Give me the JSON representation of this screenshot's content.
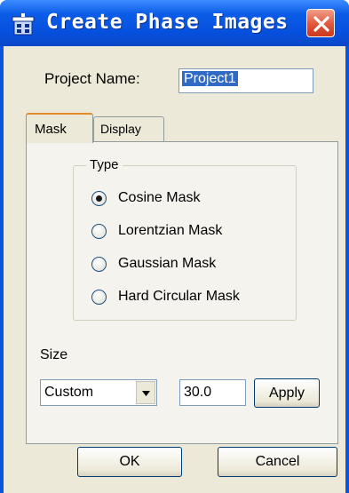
{
  "window": {
    "title": "Create Phase Images",
    "app_icon": "phase-images-app-icon",
    "close_icon": "close-icon"
  },
  "project": {
    "label": "Project Name:",
    "value": "Project1"
  },
  "tabs": [
    {
      "label": "Mask",
      "selected": true
    },
    {
      "label": "Display",
      "selected": false
    }
  ],
  "mask": {
    "type_group_label": "Type",
    "options": [
      {
        "label": "Cosine Mask",
        "checked": true
      },
      {
        "label": "Lorentzian Mask",
        "checked": false
      },
      {
        "label": "Gaussian Mask",
        "checked": false
      },
      {
        "label": "Hard Circular Mask",
        "checked": false
      }
    ],
    "size_label": "Size",
    "size_mode": "Custom",
    "size_value": "30.0",
    "apply_label": "Apply"
  },
  "buttons": {
    "ok": "OK",
    "cancel": "Cancel"
  },
  "colors": {
    "titlebar": "#0a55e0",
    "dialog_bg": "#ece9d8",
    "selection": "#316ac5",
    "close_button": "#e2553b"
  }
}
